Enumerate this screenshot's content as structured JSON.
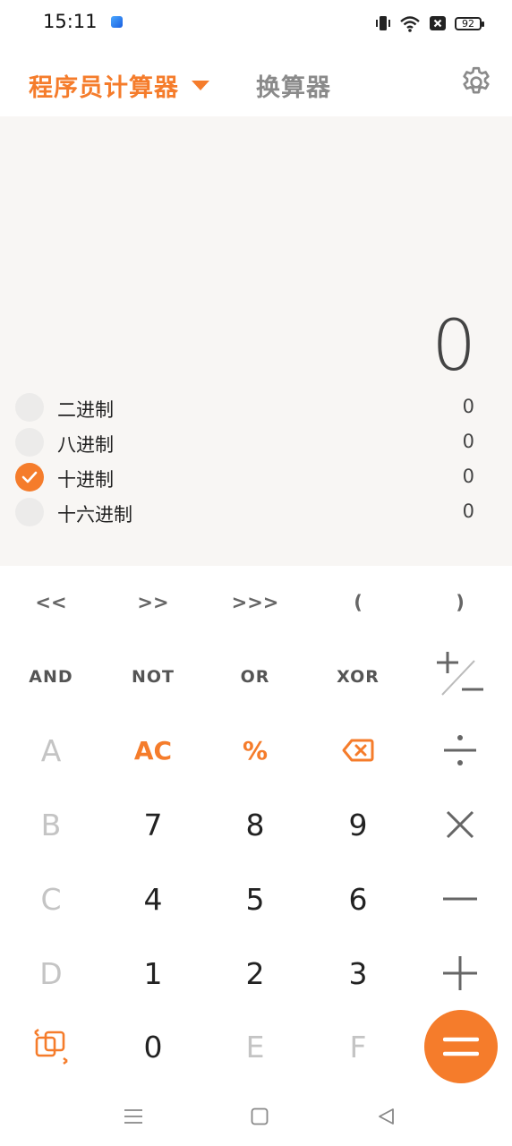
{
  "status_bar": {
    "time": "15:11",
    "battery": "92",
    "icons": [
      "app-notification-icon",
      "vibrate-icon",
      "wifi-icon",
      "no-sim-icon",
      "battery-icon"
    ]
  },
  "header": {
    "mode_title": "程序员计算器",
    "converter_tab": "换算器",
    "settings_icon": "gear-icon",
    "accent_color": "#f57c2b"
  },
  "display": {
    "main_value": "0",
    "bases": [
      {
        "label": "二进制",
        "value": "0",
        "selected": false
      },
      {
        "label": "八进制",
        "value": "0",
        "selected": false
      },
      {
        "label": "十进制",
        "value": "0",
        "selected": true
      },
      {
        "label": "十六进制",
        "value": "0",
        "selected": false
      }
    ]
  },
  "keypad": {
    "shift_row": [
      "<<",
      ">>",
      ">>>",
      "(",
      ")"
    ],
    "logic_row": [
      "AND",
      "NOT",
      "OR",
      "XOR"
    ],
    "hex_letters": [
      "A",
      "B",
      "C",
      "D",
      "E",
      "F"
    ],
    "ac": "AC",
    "percent": "%",
    "digits": {
      "d7": "7",
      "d8": "8",
      "d9": "9",
      "d4": "4",
      "d5": "5",
      "d6": "6",
      "d1": "1",
      "d2": "2",
      "d3": "3",
      "d0": "0"
    },
    "icons": [
      "plus-minus-icon",
      "backspace-icon",
      "divide-icon",
      "multiply-icon",
      "minus-icon",
      "plus-icon",
      "swap-icon",
      "equals-icon"
    ]
  },
  "navbar": {
    "icons": [
      "menu-icon",
      "home-icon",
      "back-icon"
    ]
  }
}
